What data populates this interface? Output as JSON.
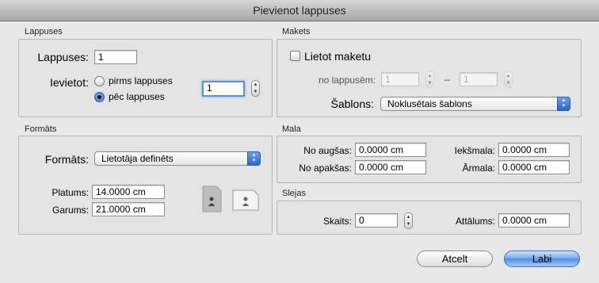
{
  "window": {
    "title": "Pievienot lappuses"
  },
  "pages": {
    "section_label": "Lappuses",
    "count_label": "Lappuses:",
    "count_value": "1",
    "insert_label": "Ievietot:",
    "option_before": "pirms lappuses",
    "option_after": "pēc lappuses",
    "selected": "pēc lappuses",
    "page_number": "1"
  },
  "master": {
    "section_label": "Makets",
    "use_master_label": "Lietot maketu",
    "use_master_checked": false,
    "from_page_label": "no lappusēm:",
    "from_value": "1",
    "dash": "–",
    "to_value": "1",
    "template_label": "Šablons:",
    "template_value": "Noklusētais šablons"
  },
  "format": {
    "section_label": "Formāts",
    "format_label": "Formāts:",
    "format_value": "Lietotāja definēts",
    "width_label": "Platums:",
    "width_value": "14.0000 cm",
    "height_label": "Garums:",
    "height_value": "21.0000 cm",
    "orientation_portrait_icon": "portrait-page-icon",
    "orientation_landscape_icon": "landscape-page-icon"
  },
  "margins": {
    "section_label": "Mala",
    "top_label": "No augšas:",
    "top_value": "0.0000 cm",
    "bottom_label": "No apakšas:",
    "bottom_value": "0.0000 cm",
    "inside_label": "Iekšmala:",
    "inside_value": "0.0000 cm",
    "outside_label": "Ārmala:",
    "outside_value": "0.0000 cm"
  },
  "columns": {
    "section_label": "Slejas",
    "count_label": "Skaits:",
    "count_value": "0",
    "gap_label": "Attālums:",
    "gap_value": "0.0000 cm"
  },
  "buttons": {
    "cancel": "Atcelt",
    "ok": "Labi"
  }
}
